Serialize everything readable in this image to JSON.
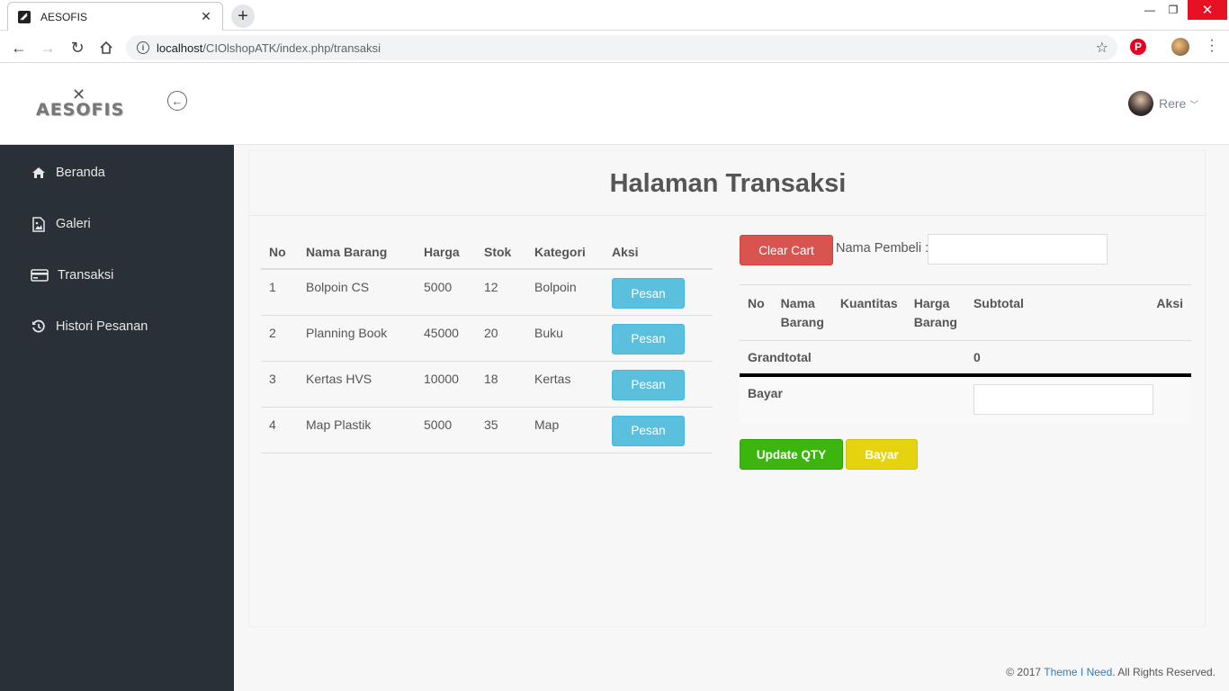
{
  "browser": {
    "tab_title": "AESOFIS",
    "url_host": "localhost",
    "url_path": "/CIOlshopATK/index.php/transaksi"
  },
  "header": {
    "logo_text": "AESOFIS",
    "user_name": "Rere"
  },
  "sidebar": {
    "items": [
      {
        "label": "Beranda",
        "icon": "home-icon"
      },
      {
        "label": "Galeri",
        "icon": "image-file-icon"
      },
      {
        "label": "Transaksi",
        "icon": "credit-card-icon"
      },
      {
        "label": "Histori Pesanan",
        "icon": "history-icon"
      }
    ]
  },
  "main": {
    "title": "Halaman Transaksi",
    "products": {
      "headers": [
        "No",
        "Nama Barang",
        "Harga",
        "Stok",
        "Kategori",
        "Aksi"
      ],
      "rows": [
        {
          "no": "1",
          "nama": "Bolpoin CS",
          "harga": "5000",
          "stok": "12",
          "kategori": "Bolpoin",
          "aksi": "Pesan"
        },
        {
          "no": "2",
          "nama": "Planning Book",
          "harga": "45000",
          "stok": "20",
          "kategori": "Buku",
          "aksi": "Pesan"
        },
        {
          "no": "3",
          "nama": "Kertas HVS",
          "harga": "10000",
          "stok": "18",
          "kategori": "Kertas",
          "aksi": "Pesan"
        },
        {
          "no": "4",
          "nama": "Map Plastik",
          "harga": "5000",
          "stok": "35",
          "kategori": "Map",
          "aksi": "Pesan"
        }
      ]
    },
    "cart": {
      "clear_label": "Clear Cart",
      "pembeli_label": "Nama Pembeli :",
      "pembeli_value": "",
      "headers": {
        "no": "No",
        "nama_1": "Nama",
        "nama_2": "Barang",
        "kuantitas": "Kuantitas",
        "harga_1": "Harga",
        "harga_2": "Barang",
        "subtotal": "Subtotal",
        "aksi": "Aksi"
      },
      "grandtotal_label": "Grandtotal",
      "grandtotal_value": "0",
      "bayar_label": "Bayar",
      "bayar_value": "",
      "update_label": "Update QTY",
      "bayar_button": "Bayar"
    }
  },
  "footer": {
    "prefix": "© 2017 ",
    "link": "Theme I Need",
    "suffix": ". All Rights Reserved."
  },
  "colors": {
    "sidebar_bg": "#2a3038",
    "pesan": "#5bc0de",
    "clear": "#d9534f",
    "update": "#3db50f",
    "bayar": "#e5d30f",
    "link": "#337ab7"
  }
}
